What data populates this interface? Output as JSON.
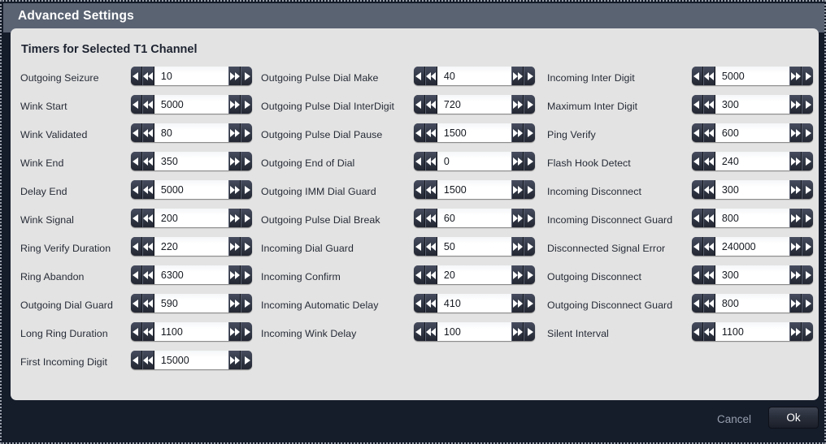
{
  "window": {
    "title": "Advanced Settings"
  },
  "panel": {
    "section_title": "Timers for Selected T1 Channel"
  },
  "spinner_icons": {
    "step_down": "triangle-left-icon",
    "page_down": "double-triangle-left-icon",
    "page_up": "double-triangle-right-icon",
    "step_up": "triangle-right-icon"
  },
  "columns": [
    {
      "name": "column-left",
      "rows": [
        {
          "label": "Outgoing Seizure",
          "value": "10"
        },
        {
          "label": "Wink Start",
          "value": "5000"
        },
        {
          "label": "Wink Validated",
          "value": "80"
        },
        {
          "label": "Wink End",
          "value": "350"
        },
        {
          "label": "Delay End",
          "value": "5000"
        },
        {
          "label": "Wink Signal",
          "value": "200"
        },
        {
          "label": "Ring Verify Duration",
          "value": "220"
        },
        {
          "label": "Ring Abandon",
          "value": "6300"
        },
        {
          "label": "Outgoing Dial Guard",
          "value": "590"
        },
        {
          "label": "Long Ring Duration",
          "value": "1100"
        },
        {
          "label": "First Incoming Digit",
          "value": "15000"
        }
      ]
    },
    {
      "name": "column-middle",
      "rows": [
        {
          "label": "Outgoing Pulse Dial Make",
          "value": "40"
        },
        {
          "label": "Outgoing Pulse Dial InterDigit",
          "value": "720"
        },
        {
          "label": "Outgoing Pulse Dial Pause",
          "value": "1500"
        },
        {
          "label": "Outgoing End of Dial",
          "value": "0"
        },
        {
          "label": "Outgoing IMM Dial Guard",
          "value": "1500"
        },
        {
          "label": "Outgoing Pulse Dial Break",
          "value": "60"
        },
        {
          "label": "Incoming Dial Guard",
          "value": "50"
        },
        {
          "label": "Incoming Confirm",
          "value": "20"
        },
        {
          "label": "Incoming Automatic Delay",
          "value": "410"
        },
        {
          "label": "Incoming Wink Delay",
          "value": "100"
        }
      ]
    },
    {
      "name": "column-right",
      "rows": [
        {
          "label": "Incoming Inter Digit",
          "value": "5000"
        },
        {
          "label": "Maximum Inter Digit",
          "value": "300"
        },
        {
          "label": "Ping Verify",
          "value": "600"
        },
        {
          "label": "Flash Hook Detect",
          "value": "240"
        },
        {
          "label": "Incoming Disconnect",
          "value": "300"
        },
        {
          "label": "Incoming Disconnect Guard",
          "value": "800"
        },
        {
          "label": "Disconnected Signal Error",
          "value": "240000"
        },
        {
          "label": "Outgoing Disconnect",
          "value": "300"
        },
        {
          "label": "Outgoing Disconnect Guard",
          "value": "800"
        },
        {
          "label": "Silent Interval",
          "value": "1100"
        }
      ]
    }
  ],
  "footer": {
    "cancel_label": "Cancel",
    "ok_label": "Ok"
  },
  "colors": {
    "titlebar": "#5a6372",
    "panel": "#e3e3e3",
    "footer": "#151c2a",
    "spinner_dark": "#2b2f3c",
    "text_dark": "#262b36"
  }
}
